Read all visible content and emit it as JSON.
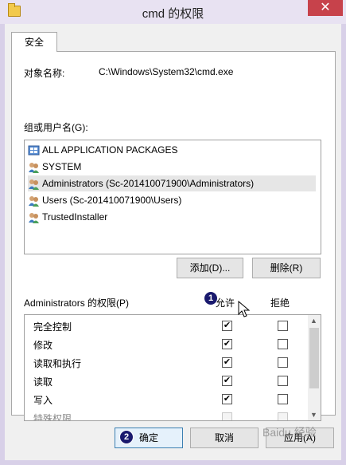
{
  "window": {
    "title": "cmd 的权限",
    "close": "✕"
  },
  "tab": {
    "label": "安全"
  },
  "object": {
    "label": "对象名称:",
    "value": "C:\\Windows\\System32\\cmd.exe"
  },
  "groups": {
    "label": "组或用户名(G):",
    "items": [
      {
        "label": "ALL APPLICATION PACKAGES",
        "icon": "packages-icon"
      },
      {
        "label": "SYSTEM",
        "icon": "users-icon"
      },
      {
        "label": "Administrators (Sc-201410071900\\Administrators)",
        "icon": "users-icon",
        "selected": true
      },
      {
        "label": "Users (Sc-201410071900\\Users)",
        "icon": "users-icon"
      },
      {
        "label": "TrustedInstaller",
        "icon": "users-icon"
      }
    ]
  },
  "buttons": {
    "add": "添加(D)...",
    "remove": "删除(R)",
    "ok": "确定",
    "cancel": "取消",
    "apply": "应用(A)"
  },
  "permissions": {
    "header": "Administrators 的权限(P)",
    "allow_label": "允许",
    "deny_label": "拒绝",
    "rows": [
      {
        "name": "完全控制",
        "allow": true,
        "deny": false
      },
      {
        "name": "修改",
        "allow": true,
        "deny": false
      },
      {
        "name": "读取和执行",
        "allow": true,
        "deny": false
      },
      {
        "name": "读取",
        "allow": true,
        "deny": false
      },
      {
        "name": "写入",
        "allow": true,
        "deny": false
      },
      {
        "name": "特殊权限",
        "allow": false,
        "deny": false,
        "disabled": true
      }
    ]
  },
  "annotations": {
    "badge1": "1",
    "badge2": "2"
  },
  "watermark": "Baidu 经验"
}
